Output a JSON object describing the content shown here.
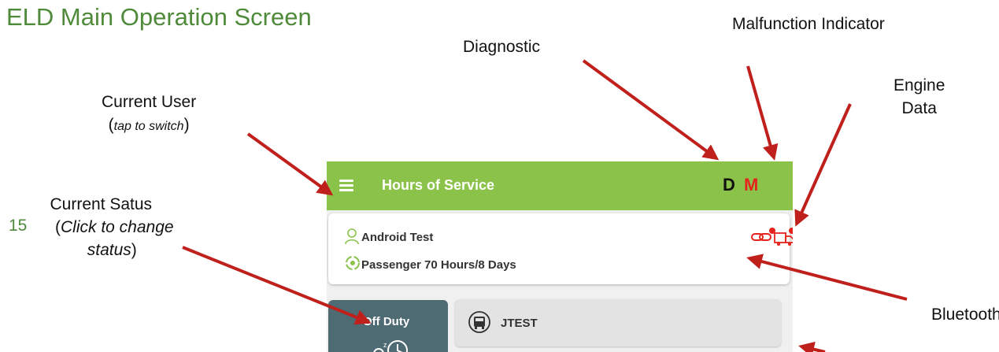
{
  "slide": {
    "title": "ELD Main Operation Screen",
    "page_number": "15"
  },
  "callouts": {
    "diagnostic": "Diagnostic",
    "malfunction": "Malfunction Indicator",
    "engine_line1": "Engine",
    "engine_line2": "Data",
    "current_user": "Current User",
    "current_user_paren_open": "(",
    "current_user_sub": "tap to switch",
    "current_user_paren_close": ")",
    "status_title": "Current Satus",
    "status_paren_open": "(",
    "status_sub1": "Click to change",
    "status_sub2": "status",
    "status_paren_close": ")",
    "bluetooth": "Bluetooth"
  },
  "app": {
    "title": "Hours of Service",
    "diagnostic_indicator": "D",
    "malfunction_indicator": "M",
    "user_name": "Android Test",
    "ruleset": "Passenger 70 Hours/8 Days",
    "status": "Off Duty",
    "vehicle": "JTEST",
    "colors": {
      "appbar": "#8bc34a",
      "malfunction": "#e5231c",
      "status_tile": "#4e6a72",
      "arrow": "#c0201c",
      "title_green": "#4f8a3a"
    },
    "icons": [
      "menu-icon",
      "user-icon",
      "cycle-icon",
      "bluetooth-link-icon",
      "engine-truck-icon",
      "sleep-clock-icon",
      "vehicle-icon"
    ]
  }
}
